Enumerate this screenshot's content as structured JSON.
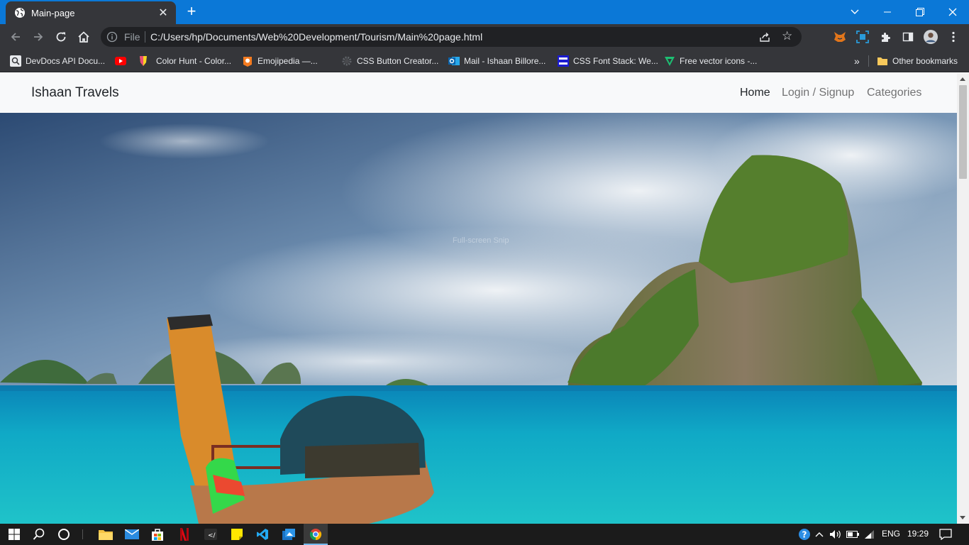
{
  "browser": {
    "tab_title": "Main-page",
    "file_label": "File",
    "url": "C:/Users/hp/Documents/Web%20Development/Tourism/Main%20page.html",
    "bookmarks": [
      "DevDocs API Docu...",
      "Color Hunt - Color...",
      "Emojipedia —...",
      "CSS Button Creator...",
      "Mail - Ishaan Billore...",
      "CSS Font Stack: We...",
      "Free vector icons -..."
    ],
    "more_bookmarks": "»",
    "other_bookmarks": "Other bookmarks",
    "accent": "#0b78d7"
  },
  "site": {
    "brand": "Ishaan Travels",
    "nav": {
      "home": "Home",
      "login": "Login / Signup",
      "categories": "Categories"
    },
    "hero_overlay_text": "Full-screen Snip"
  },
  "taskbar": {
    "language": "ENG",
    "time": "19:29"
  }
}
